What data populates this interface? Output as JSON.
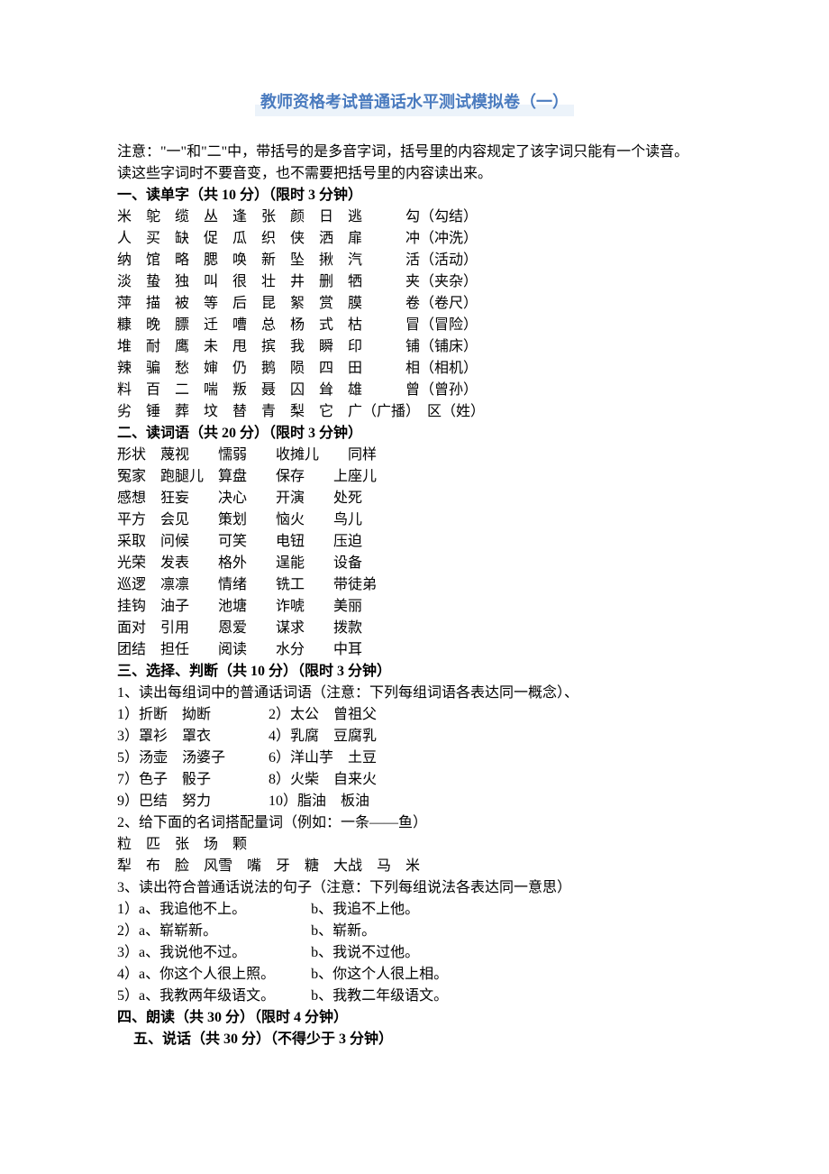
{
  "title": "教师资格考试普通话水平测试模拟卷（一）",
  "note1": "注意：\"一\"和\"二\"中，带括号的是多音字词，括号里的内容规定了该字词只能有一个读音。",
  "note2": "读这些字词时不要音变，也不需要把括号里的内容读出来。",
  "s1": {
    "head": "一、读单字（共 10 分）（限时 3 分钟）",
    "rows": [
      "米　鸵　缆　丛　逢　张　颜　日　逃　　　勾（勾结）",
      "人　买　缺　促　瓜　织　侠　洒　扉　　　冲（冲洗）",
      "纳　馆　略　腮　唤　新　坠　揪　汽　　　活（活动）",
      "淡　蛰　独　叫　很　壮　井　删　牺　　　夹（夹杂）",
      "萍　描　被　等　后　昆　絮　赏　膜　　　卷（卷尺）",
      "糠　晚　膘　迁　嘈　总　杨　式　枯　　　冒（冒险）",
      "堆　耐　鹰　未　甩　摈　我　瞬　印　　　铺（铺床）",
      "辣　骗　愁　婶　仍　鹅　陨　四　田　　　相（相机）",
      "料　百　二　喘　叛　聂　囚　耸　雄　　　曾（曾孙）",
      "劣　锤　葬　坟　替　青　梨　它　广（广播）　区（姓）"
    ]
  },
  "s2": {
    "head": "二、读词语（共 20 分）（限时 3 分钟）",
    "rows": [
      "形状　蔑视　　懦弱　　收摊儿　　同样",
      "冤家　跑腿儿　算盘　　保存　　上座儿",
      "感想　狂妄　　决心　　开演　　处死",
      "平方　会见　　策划　　恼火　　鸟儿",
      "采取　问候　　可笑　　电钮　　压迫",
      "光荣　发表　　格外　　逞能　　设备",
      "巡逻　凛凛　　情绪　　铣工　　带徒弟",
      "挂钩　油子　　池塘　　诈唬　　美丽",
      "面对　引用　　恩爱　　谋求　　拨款",
      "团结　担任　　阅读　　水分　　中耳"
    ]
  },
  "s3": {
    "head": "三、选择、判断（共 10 分）（限时 3 分钟）",
    "q1": "1、读出每组词中的普通话词语（注意：下列每组词语各表达同一概念）、",
    "q1rows": [
      "1）折断　拗断　　　　2）太公　曾祖父",
      "3）罩衫　罩衣　　　　4）乳腐　豆腐乳",
      "5）汤壶　汤婆子　　　6）洋山芋　土豆",
      "7）色子　骰子　　　　8）火柴　自来火",
      "9）巴结　努力　　　　10）脂油　板油"
    ],
    "q2": "2、给下面的名词搭配量词（例如：一条——鱼）",
    "q2rows": [
      "粒　匹　张　场　颗",
      "犁　布　脸　风雪　嘴　牙　糖　大战　马　米"
    ],
    "q3": "3、读出符合普通话说法的句子（注意：下列每组说法各表达同一意思）",
    "q3rows": [
      "1）a、我追他不上。　　　　　b、我追不上他。",
      "2）a、崭崭新。　　　　　　　b、崭新。",
      "3）a、我说他不过。　　　　　b、我说不过他。",
      "4）a、你这个人很上照。　　　b、你这个人很上相。",
      "5）a、我教两年级语文。　　　b、我教二年级语文。"
    ]
  },
  "s4": "四、朗读（共 30 分）（限时 4 分钟）",
  "s5": "五、说话（共 30 分）（不得少于 3 分钟）"
}
